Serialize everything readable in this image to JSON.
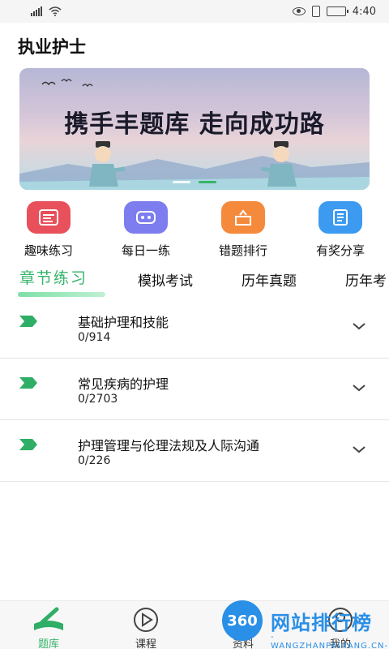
{
  "status_bar": {
    "time": "4:40",
    "battery_level": 0.7
  },
  "app_title": "执业护士",
  "banner": {
    "text": "携手丰题库 走向成功路",
    "slide_count": 2,
    "active_slide": 2
  },
  "quick_menu": [
    {
      "label": "趣味练习",
      "icon": "fun-practice-icon",
      "color": "#e8505b"
    },
    {
      "label": "每日一练",
      "icon": "daily-practice-icon",
      "color": "#7d7df0"
    },
    {
      "label": "错题排行",
      "icon": "wrong-ranking-icon",
      "color": "#f58a3c"
    },
    {
      "label": "有奖分享",
      "icon": "share-reward-icon",
      "color": "#3c9bf0"
    }
  ],
  "tabs": [
    {
      "label": "章节练习",
      "active": true
    },
    {
      "label": "模拟考试"
    },
    {
      "label": "历年真题"
    },
    {
      "label": "历年考"
    }
  ],
  "chapters": [
    {
      "title": "基础护理和技能",
      "progress": "0/914"
    },
    {
      "title": "常见疾病的护理",
      "progress": "0/2703"
    },
    {
      "title": "护理管理与伦理法规及人际沟通",
      "progress": "0/226"
    }
  ],
  "bottom_nav": [
    {
      "label": "题库",
      "icon": "book-icon",
      "active": true
    },
    {
      "label": "课程",
      "icon": "play-icon"
    },
    {
      "label": "资料",
      "icon": "doc-icon"
    },
    {
      "label": "我的",
      "icon": "user-icon"
    }
  ],
  "watermark": {
    "badge": "360",
    "title": "网站排行榜",
    "subtitle": "-WANGZHANPAIHANG.CN-"
  },
  "colors": {
    "accent": "#36b36b",
    "watermark": "#2a8fe6"
  }
}
